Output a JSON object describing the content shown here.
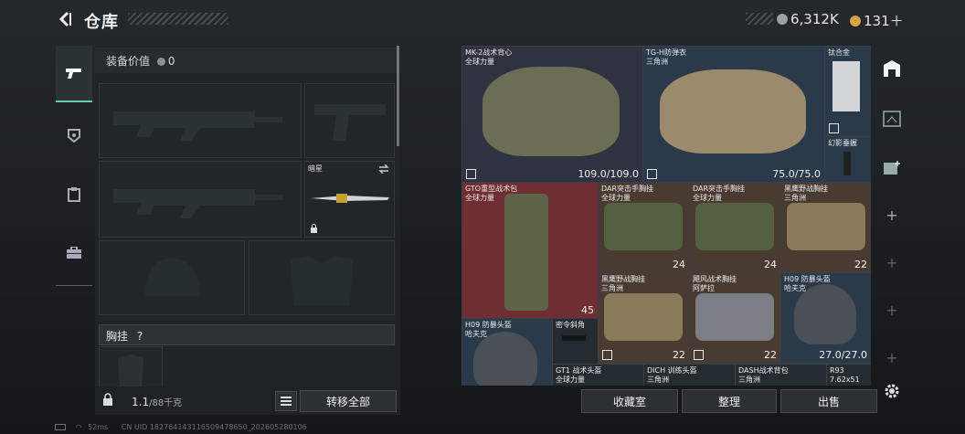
{
  "header": {
    "back_icon": "back-arrow-icon",
    "title": "仓库"
  },
  "currency": {
    "silver": "6,312K",
    "gold": "131＋",
    "silver_color": "#9aa0a4",
    "gold_color": "#d9a441"
  },
  "tabs": [
    {
      "icon": "pistol-icon",
      "active": true
    },
    {
      "icon": "armor-badge-icon",
      "active": false
    },
    {
      "icon": "clipboard-icon",
      "active": false
    },
    {
      "icon": "briefcase-icon",
      "active": false
    }
  ],
  "equipment": {
    "value_label": "装备价值",
    "value": "0",
    "knife_name": "暗星",
    "chest_label": "胸挂",
    "chest_help": "?",
    "weight_current": "1.1",
    "weight_max": "/88千克",
    "transfer_all": "转移全部"
  },
  "grid": {
    "items": [
      {
        "name": "MK-2战术背心\n全球力量",
        "value": "109.0/109.0"
      },
      {
        "name": "TG-H防弹衣\n三角洲",
        "value": "75.0/75.0"
      },
      {
        "name": "钛合金",
        "value": ""
      },
      {
        "name": "幻影垂握",
        "value": ""
      },
      {
        "name": "GTO重型战术包\n全球力量",
        "value": "45"
      },
      {
        "name": "DAR突击手胸挂\n全球力量",
        "value": "24"
      },
      {
        "name": "DAR突击手胸挂\n全球力量",
        "value": "24"
      },
      {
        "name": "黑鹰野战胸挂\n三角洲",
        "value": "22"
      },
      {
        "name": "黑鹰野战胸挂\n三角洲",
        "value": "22"
      },
      {
        "name": "飓风战术胸挂\n阿萨拉",
        "value": "22"
      },
      {
        "name": "H09 防暴头盔\n哈夫克",
        "value": "27.0/27.0"
      },
      {
        "name": "H09 防暴头盔\n哈夫克",
        "value": ""
      },
      {
        "name": "密令斜角",
        "value": ""
      },
      {
        "name": "GT1 战术头盔\n全球力量",
        "value": ""
      },
      {
        "name": "DICH 训练头盔\n三角洲",
        "value": ""
      },
      {
        "name": "DASH战术背包\n三角洲",
        "value": ""
      },
      {
        "name": "R93\n7.62x51",
        "value": ""
      }
    ]
  },
  "actions": {
    "collection": "收藏室",
    "organize": "整理",
    "sell": "出售"
  },
  "side_icons": [
    "storage-icon",
    "level-frame-icon",
    "add-image-icon",
    "plus-icon",
    "plus-icon",
    "plus-icon",
    "plus-icon",
    "settings-icon"
  ],
  "footer": {
    "ping": "52ms",
    "uid": "CN UID 18276414311650947865​0_202605280106"
  }
}
